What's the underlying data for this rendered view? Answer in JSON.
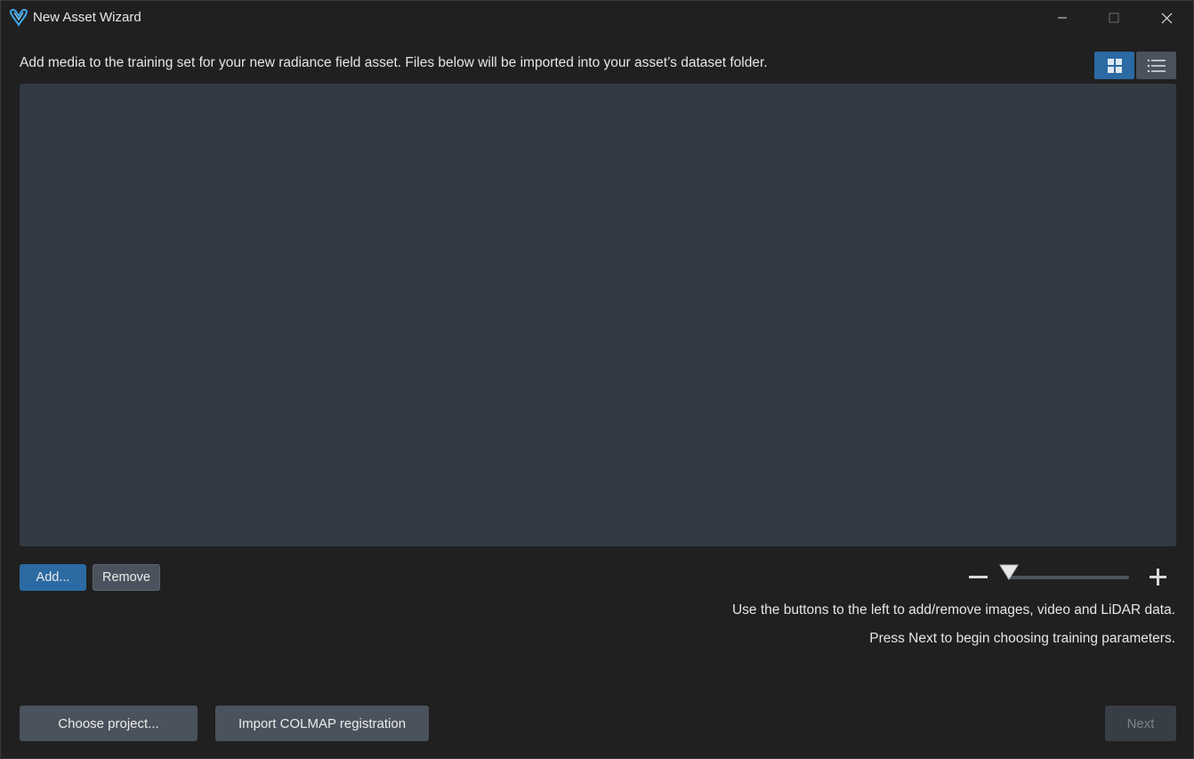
{
  "window": {
    "title": "New Asset Wizard",
    "icon": "app-logo-icon",
    "controls": {
      "minimize": "minimize-icon",
      "maximize": "maximize-icon",
      "close": "close-icon"
    }
  },
  "content": {
    "description": "Add media to the training set for your new radiance field asset. Files below will be imported into your asset’s dataset folder.",
    "view_modes": [
      {
        "name": "grid",
        "icon": "grid-view-icon",
        "active": true
      },
      {
        "name": "list",
        "icon": "list-view-icon",
        "active": false
      }
    ]
  },
  "actions": {
    "add_label": "Add...",
    "remove_label": "Remove"
  },
  "zoom": {
    "value": 0.0
  },
  "hints": {
    "line1": "Use the buttons to the left to add/remove images, video and LiDAR data.",
    "line2": "Press Next to begin choosing training parameters."
  },
  "footer": {
    "choose_project_label": "Choose project...",
    "import_colmap_label": "Import COLMAP registration",
    "next_label": "Next",
    "next_enabled": false
  },
  "colors": {
    "accent": "#2b6aa3",
    "background": "#202020",
    "panel": "#323a43",
    "button": "#4a535d"
  }
}
